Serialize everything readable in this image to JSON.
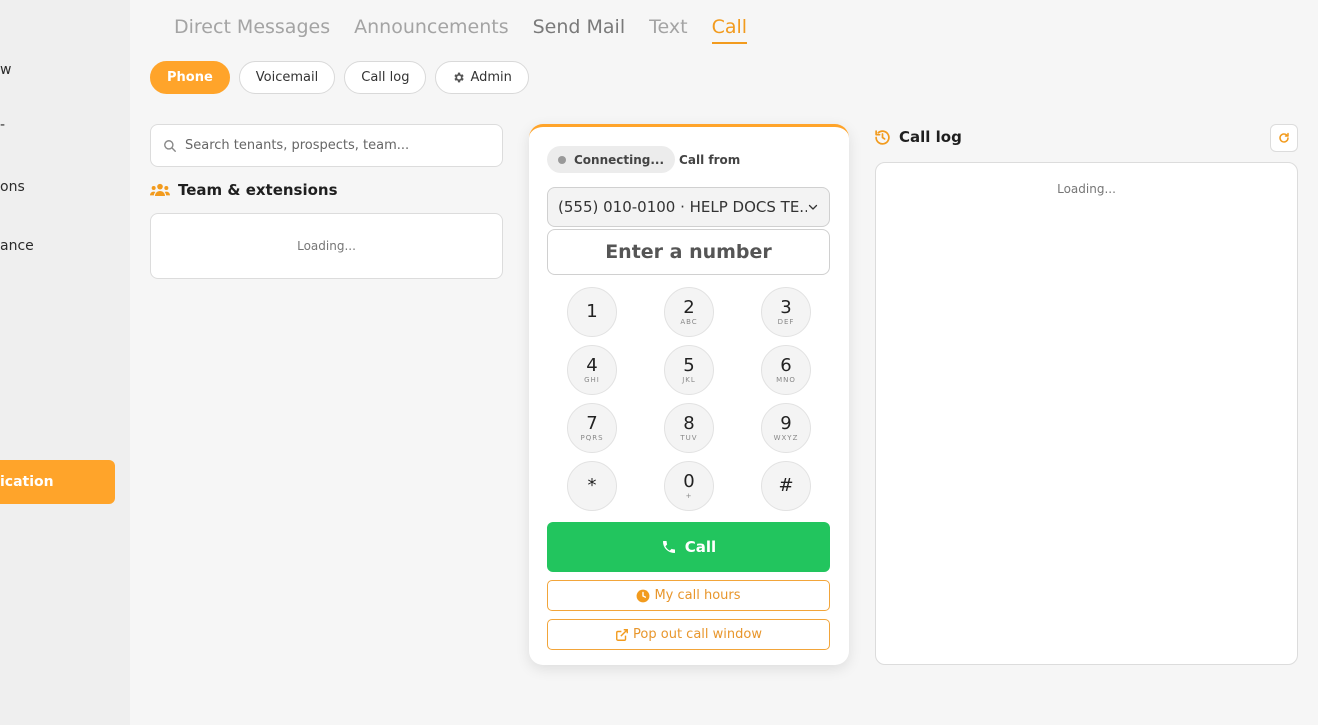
{
  "sidebar": {
    "items": [
      {
        "label": "w"
      },
      {
        "label": "-"
      },
      {
        "label": "ons"
      },
      {
        "label": "ance"
      }
    ],
    "active_label": "ication"
  },
  "tabs": [
    {
      "label": "Direct Messages"
    },
    {
      "label": "Announcements"
    },
    {
      "label": "Send Mail"
    },
    {
      "label": "Text"
    },
    {
      "label": "Call"
    }
  ],
  "subtabs": {
    "phone": "Phone",
    "voicemail": "Voicemail",
    "call_log": "Call log",
    "admin": "Admin"
  },
  "search": {
    "placeholder": "Search tenants, prospects, team..."
  },
  "team": {
    "title": "Team & extensions",
    "loading": "Loading..."
  },
  "dialer": {
    "status": "Connecting...",
    "call_from_label": "Call from",
    "from_value": "(555) 010-0100 · HELP DOCS TE...",
    "number_placeholder": "Enter a number",
    "keys": [
      {
        "digit": "1",
        "letters": ""
      },
      {
        "digit": "2",
        "letters": "ABC"
      },
      {
        "digit": "3",
        "letters": "DEF"
      },
      {
        "digit": "4",
        "letters": "GHI"
      },
      {
        "digit": "5",
        "letters": "JKL"
      },
      {
        "digit": "6",
        "letters": "MNO"
      },
      {
        "digit": "7",
        "letters": "PQRS"
      },
      {
        "digit": "8",
        "letters": "TUV"
      },
      {
        "digit": "9",
        "letters": "WXYZ"
      },
      {
        "digit": "*",
        "letters": ""
      },
      {
        "digit": "0",
        "letters": "+"
      },
      {
        "digit": "#",
        "letters": ""
      }
    ],
    "call_label": "Call",
    "hours_label": "My call hours",
    "popout_label": "Pop out call window"
  },
  "call_log": {
    "title": "Call log",
    "loading": "Loading..."
  },
  "colors": {
    "accent": "#ffa42a",
    "call_green": "#22c55e"
  }
}
